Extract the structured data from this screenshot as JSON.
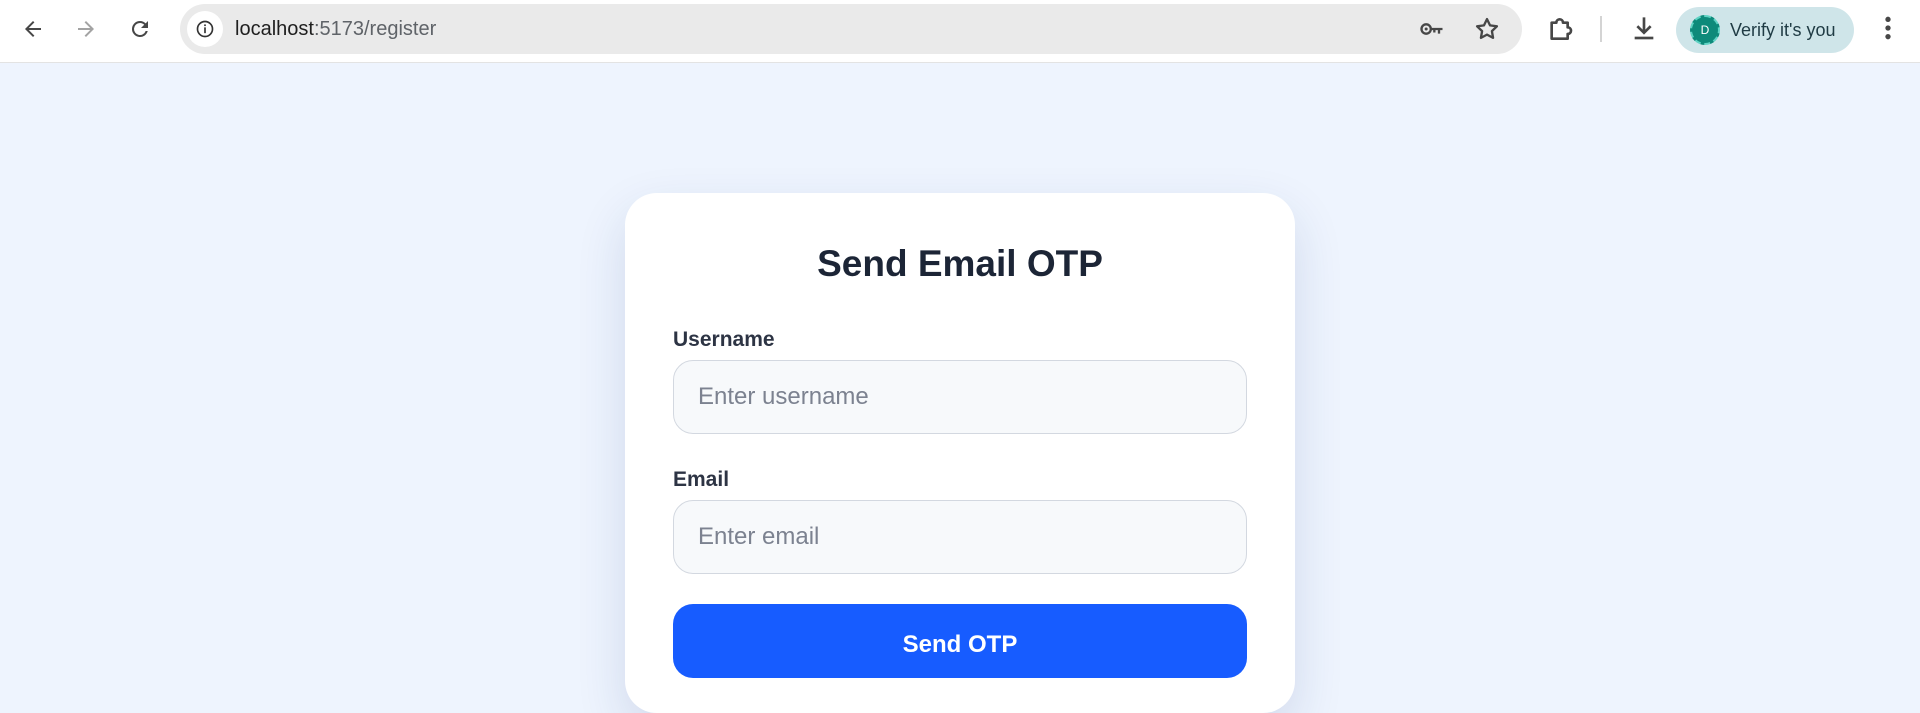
{
  "browser": {
    "url_host": "localhost",
    "url_path": ":5173/register",
    "profile": {
      "avatar_letter": "D",
      "label": "Verify it's you"
    }
  },
  "form": {
    "title": "Send Email OTP",
    "username_label": "Username",
    "username_placeholder": "Enter username",
    "email_label": "Email",
    "email_placeholder": "Enter email",
    "submit_label": "Send OTP"
  },
  "colors": {
    "page_background": "#eef4fe",
    "card_background": "#ffffff",
    "primary_button": "#175cff",
    "title_text": "#1c2536"
  },
  "icons": {
    "back": "arrow-left-icon",
    "forward": "arrow-right-icon",
    "reload": "reload-icon",
    "site_info": "info-icon",
    "password": "key-icon",
    "bookmark": "star-icon",
    "extensions": "puzzle-icon",
    "downloads": "download-icon",
    "menu": "kebab-menu-icon"
  }
}
